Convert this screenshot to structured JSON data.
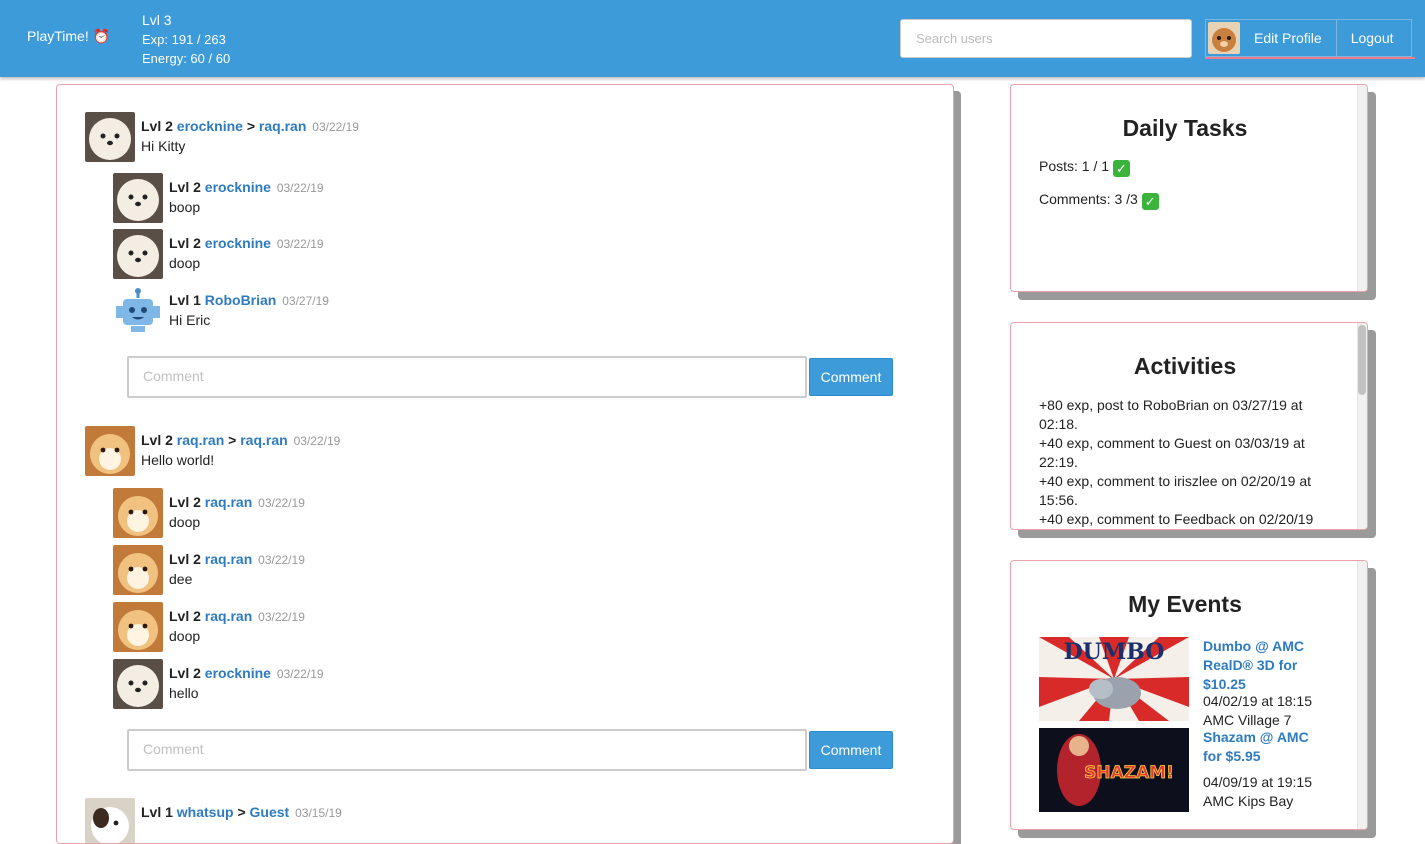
{
  "header": {
    "brand": "PlayTime! ⏰",
    "level": "Lvl 3",
    "exp": "Exp: 191 / 263",
    "energy": "Energy: 60 / 60",
    "search_placeholder": "Search users",
    "edit_profile": "Edit Profile",
    "logout": "Logout"
  },
  "feed": {
    "comment_placeholder": "Comment",
    "comment_button": "Comment",
    "posts": [
      {
        "level": "Lvl 2",
        "author": "erocknine",
        "sep": ">",
        "target": "raq.ran",
        "date": "03/22/19",
        "body": "Hi Kitty",
        "replies": [
          {
            "level": "Lvl 2",
            "author": "erocknine",
            "date": "03/22/19",
            "body": "boop"
          },
          {
            "level": "Lvl 2",
            "author": "erocknine",
            "date": "03/22/19",
            "body": "doop"
          },
          {
            "level": "Lvl 1",
            "author": "RoboBrian",
            "date": "03/27/19",
            "body": "Hi Eric"
          }
        ]
      },
      {
        "level": "Lvl 2",
        "author": "raq.ran",
        "sep": ">",
        "target": "raq.ran",
        "date": "03/22/19",
        "body": "Hello world!",
        "replies": [
          {
            "level": "Lvl 2",
            "author": "raq.ran",
            "date": "03/22/19",
            "body": "doop"
          },
          {
            "level": "Lvl 2",
            "author": "raq.ran",
            "date": "03/22/19",
            "body": "dee"
          },
          {
            "level": "Lvl 2",
            "author": "raq.ran",
            "date": "03/22/19",
            "body": "doop"
          },
          {
            "level": "Lvl 2",
            "author": "erocknine",
            "date": "03/22/19",
            "body": "hello"
          }
        ]
      },
      {
        "level": "Lvl 1",
        "author": "whatsup",
        "sep": ">",
        "target": "Guest",
        "date": "03/15/19",
        "body": "",
        "replies": []
      }
    ]
  },
  "daily_tasks": {
    "title": "Daily Tasks",
    "posts": "Posts: 1 / 1",
    "comments": "Comments: 3 /3",
    "check": "✓"
  },
  "activities": {
    "title": "Activities",
    "items": [
      "+80 exp, post to RoboBrian on 03/27/19 at 02:18.",
      "+40 exp, comment to Guest on 03/03/19 at 22:19.",
      "+40 exp, comment to iriszlee on 02/20/19 at 15:56.",
      "+40 exp, comment to Feedback on 02/20/19"
    ]
  },
  "my_events": {
    "title": "My Events",
    "events": [
      {
        "title": "Dumbo @ AMC RealD® 3D for $10.25",
        "when": "04/02/19 at 18:15",
        "where": "AMC Village 7",
        "poster_text": "DUMBO"
      },
      {
        "title": "Shazam @ AMC for $5.95",
        "when": "04/09/19 at 19:15",
        "where": "AMC Kips Bay",
        "poster_text": "SHAZAM!"
      }
    ]
  },
  "colors": {
    "accent": "#3d9bd9",
    "link": "#2e7bbf",
    "panel_border": "#e8a3ab",
    "check": "#3cb43c"
  }
}
